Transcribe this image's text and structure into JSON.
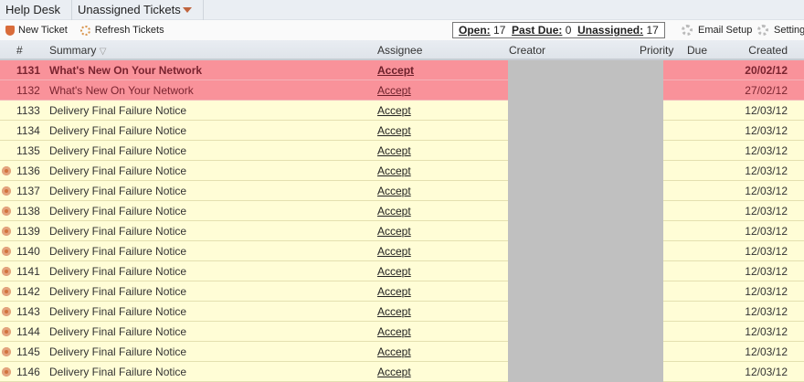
{
  "breadcrumb": [
    "Help Desk",
    "Unassigned Tickets"
  ],
  "toolbar": {
    "new_ticket": "New Ticket",
    "refresh": "Refresh Tickets",
    "email_setup": "Email Setup",
    "settings": "Settings",
    "open_label": "Open:",
    "open": "17",
    "past_due_label": "Past Due:",
    "past_due": "0",
    "unassigned_label": "Unassigned:",
    "unassigned": "17"
  },
  "columns": {
    "num": "#",
    "summary": "Summary",
    "assignee": "Assignee",
    "creator": "Creator",
    "priority": "Priority",
    "due": "Due",
    "created": "Created"
  },
  "rows": [
    {
      "num": "1131",
      "summary": "What's New On Your Network",
      "assignee": "Accept",
      "created": "20/02/12",
      "style": "pink bold",
      "dot": false
    },
    {
      "num": "1132",
      "summary": "What's New On Your Network",
      "assignee": "Accept",
      "created": "27/02/12",
      "style": "pink",
      "dot": false
    },
    {
      "num": "1133",
      "summary": "Delivery Final Failure Notice",
      "assignee": "Accept",
      "created": "12/03/12",
      "style": "",
      "dot": false
    },
    {
      "num": "1134",
      "summary": "Delivery Final Failure Notice",
      "assignee": "Accept",
      "created": "12/03/12",
      "style": "",
      "dot": false
    },
    {
      "num": "1135",
      "summary": "Delivery Final Failure Notice",
      "assignee": "Accept",
      "created": "12/03/12",
      "style": "",
      "dot": false
    },
    {
      "num": "1136",
      "summary": "Delivery Final Failure Notice",
      "assignee": "Accept",
      "created": "12/03/12",
      "style": "",
      "dot": true
    },
    {
      "num": "1137",
      "summary": "Delivery Final Failure Notice",
      "assignee": "Accept",
      "created": "12/03/12",
      "style": "",
      "dot": true
    },
    {
      "num": "1138",
      "summary": "Delivery Final Failure Notice",
      "assignee": "Accept",
      "created": "12/03/12",
      "style": "",
      "dot": true
    },
    {
      "num": "1139",
      "summary": "Delivery Final Failure Notice",
      "assignee": "Accept",
      "created": "12/03/12",
      "style": "",
      "dot": true
    },
    {
      "num": "1140",
      "summary": "Delivery Final Failure Notice",
      "assignee": "Accept",
      "created": "12/03/12",
      "style": "",
      "dot": true
    },
    {
      "num": "1141",
      "summary": "Delivery Final Failure Notice",
      "assignee": "Accept",
      "created": "12/03/12",
      "style": "",
      "dot": true
    },
    {
      "num": "1142",
      "summary": "Delivery Final Failure Notice",
      "assignee": "Accept",
      "created": "12/03/12",
      "style": "",
      "dot": true
    },
    {
      "num": "1143",
      "summary": "Delivery Final Failure Notice",
      "assignee": "Accept",
      "created": "12/03/12",
      "style": "",
      "dot": true
    },
    {
      "num": "1144",
      "summary": "Delivery Final Failure Notice",
      "assignee": "Accept",
      "created": "12/03/12",
      "style": "",
      "dot": true
    },
    {
      "num": "1145",
      "summary": "Delivery Final Failure Notice",
      "assignee": "Accept",
      "created": "12/03/12",
      "style": "",
      "dot": true
    },
    {
      "num": "1146",
      "summary": "Delivery Final Failure Notice",
      "assignee": "Accept",
      "created": "12/03/12",
      "style": "",
      "dot": true
    }
  ]
}
